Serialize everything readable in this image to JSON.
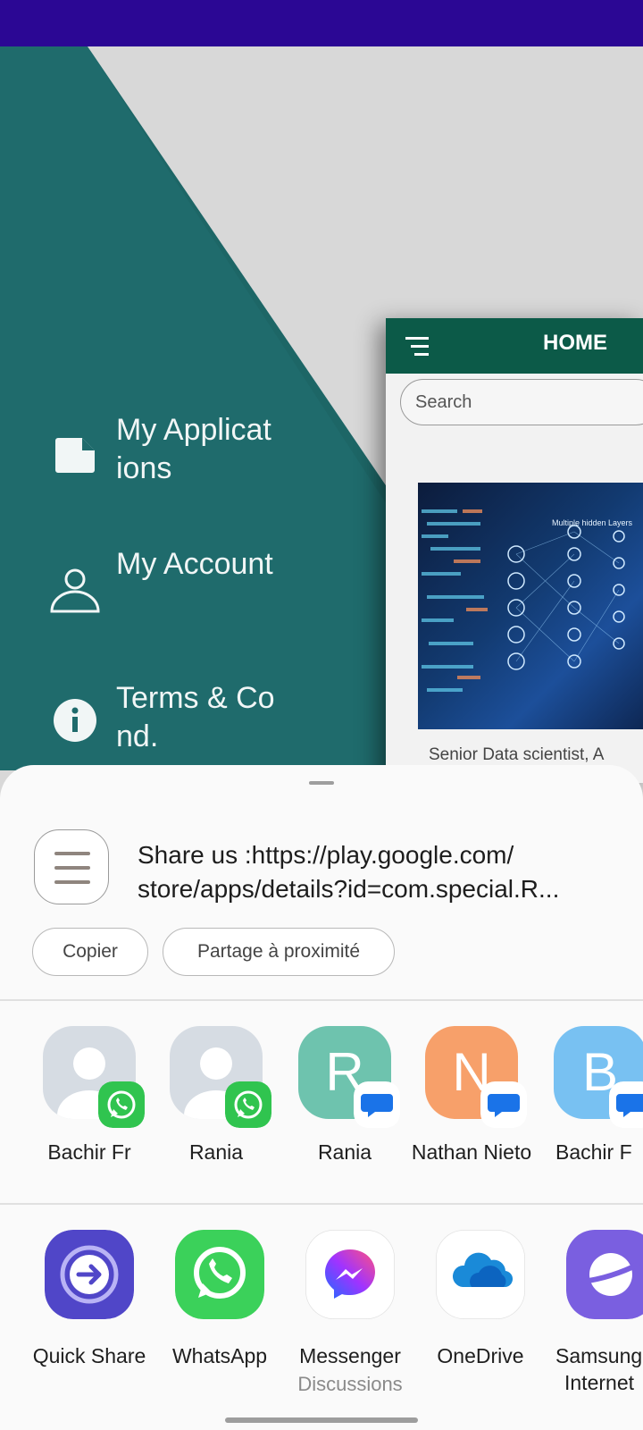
{
  "drawer": {
    "items": [
      {
        "label": "My Applications",
        "icon": "document-icon"
      },
      {
        "label": "My Account",
        "icon": "person-icon"
      },
      {
        "label": "Terms & Cond.",
        "icon": "info-icon"
      }
    ]
  },
  "preview": {
    "title": "HOME",
    "search_placeholder": "Search",
    "card_caption": "Senior Data scientist, A",
    "image_label": "Multiple hidden Layers"
  },
  "share": {
    "text_line1": "Share us :https://play.google.com/",
    "text_line2": "store/apps/details?id=com.special.R...",
    "chips": [
      "Copier",
      "Partage à proximité"
    ],
    "contacts": [
      {
        "name": "Bachir Fr",
        "initial": "",
        "badge": "whatsapp-badge-icon",
        "color": "#d6dce3"
      },
      {
        "name": "Rania",
        "initial": "",
        "badge": "whatsapp-badge-icon",
        "color": "#d6dce3"
      },
      {
        "name": "Rania",
        "initial": "R",
        "badge": "messages-badge-icon",
        "color": "#6ec3ae"
      },
      {
        "name": "Nathan Nieto",
        "initial": "N",
        "badge": "messages-badge-icon",
        "color": "#f7a06a"
      },
      {
        "name": "Bachir F",
        "initial": "B",
        "badge": "messages-badge-icon",
        "color": "#78c1f2"
      }
    ],
    "apps": [
      {
        "name": "Quick Share",
        "sub": "",
        "icon": "quick-share-icon"
      },
      {
        "name": "WhatsApp",
        "sub": "",
        "icon": "whatsapp-icon"
      },
      {
        "name": "Messenger",
        "sub": "Discussions",
        "icon": "messenger-icon"
      },
      {
        "name": "OneDrive",
        "sub": "",
        "icon": "onedrive-icon"
      },
      {
        "name": "Samsung",
        "name2": "Internet",
        "icon": "samsung-internet-icon"
      }
    ]
  }
}
